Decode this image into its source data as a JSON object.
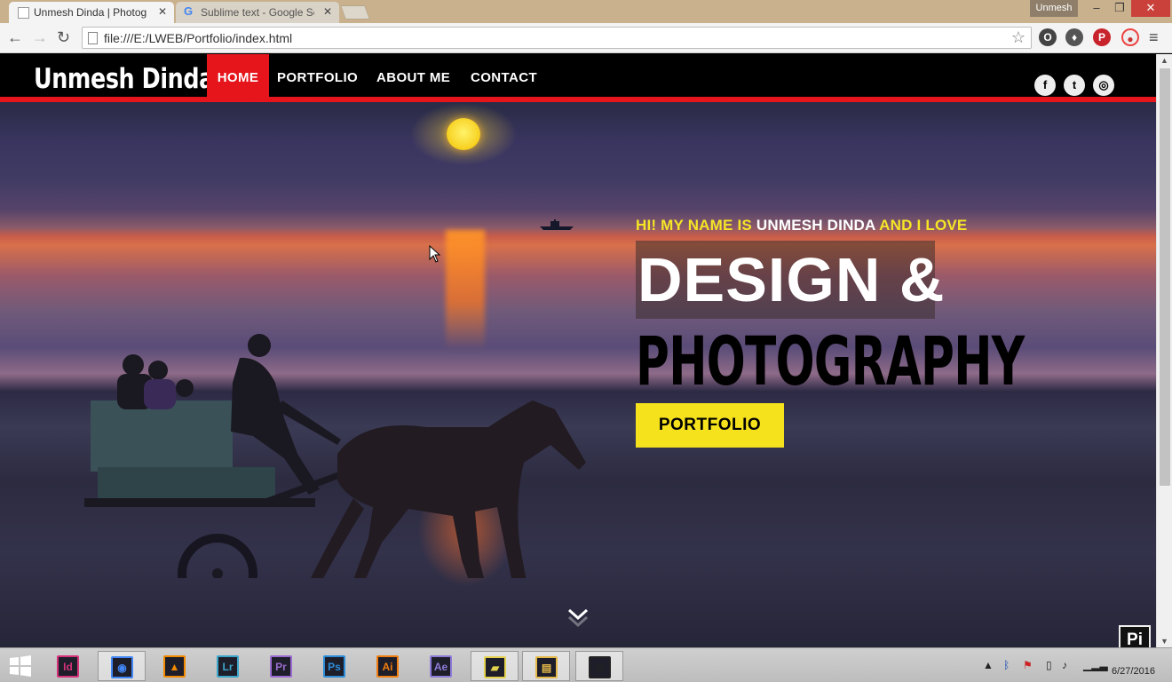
{
  "browser": {
    "tabs": [
      {
        "title": "Unmesh Dinda | Photogra",
        "active": true
      },
      {
        "title": "Sublime text - Google Sea",
        "active": false
      }
    ],
    "user": "Unmesh",
    "url": "file:///E:/LWEB/Portfolio/index.html",
    "close_glyph": "✕",
    "min_glyph": "–",
    "max_glyph": "❐",
    "back_glyph": "←",
    "forward_glyph": "→",
    "reload_glyph": "↻",
    "star_glyph": "☆",
    "menu_glyph": "≡"
  },
  "site": {
    "logo": "Unmesh Dinda",
    "nav": [
      {
        "label": "HOME",
        "active": true
      },
      {
        "label": "PORTFOLIO",
        "active": false
      },
      {
        "label": "ABOUT ME",
        "active": false
      },
      {
        "label": "CONTACT",
        "active": false
      }
    ],
    "social": [
      {
        "icon": "facebook-icon",
        "glyph": "f"
      },
      {
        "icon": "twitter-icon",
        "glyph": "t"
      },
      {
        "icon": "instagram-icon",
        "glyph": "◎"
      }
    ],
    "hero": {
      "intro_prefix": "HI! MY NAME IS ",
      "intro_name": "UNMESH DINDA",
      "intro_suffix": " AND I LOVE",
      "line1": "DESIGN &",
      "line2": "PHOTOGRAPHY",
      "cta": "PORTFOLIO"
    },
    "colors": {
      "accent_red": "#e6151c",
      "accent_yellow": "#f5e21c"
    }
  },
  "taskbar": {
    "apps": [
      {
        "name": "Id",
        "color": "#d4317a",
        "active": false
      },
      {
        "name": "Chrome",
        "color": "#4285f4",
        "active": true
      },
      {
        "name": "VLC",
        "color": "#f18a00",
        "active": false
      },
      {
        "name": "Lr",
        "color": "#3ba5c9",
        "active": false
      },
      {
        "name": "Pr",
        "color": "#9a6bd0",
        "active": false
      },
      {
        "name": "Ps",
        "color": "#2c8cd8",
        "active": false
      },
      {
        "name": "Ai",
        "color": "#f07d10",
        "active": false
      },
      {
        "name": "Ae",
        "color": "#8e7ad8",
        "active": false
      },
      {
        "name": "Sticky",
        "color": "#e3d24d",
        "active": true
      },
      {
        "name": "Explorer",
        "color": "#e4b94a",
        "active": true
      },
      {
        "name": "OBS",
        "color": "#222",
        "active": true
      }
    ],
    "date": "6/27/2016",
    "watermark": "Pi"
  }
}
